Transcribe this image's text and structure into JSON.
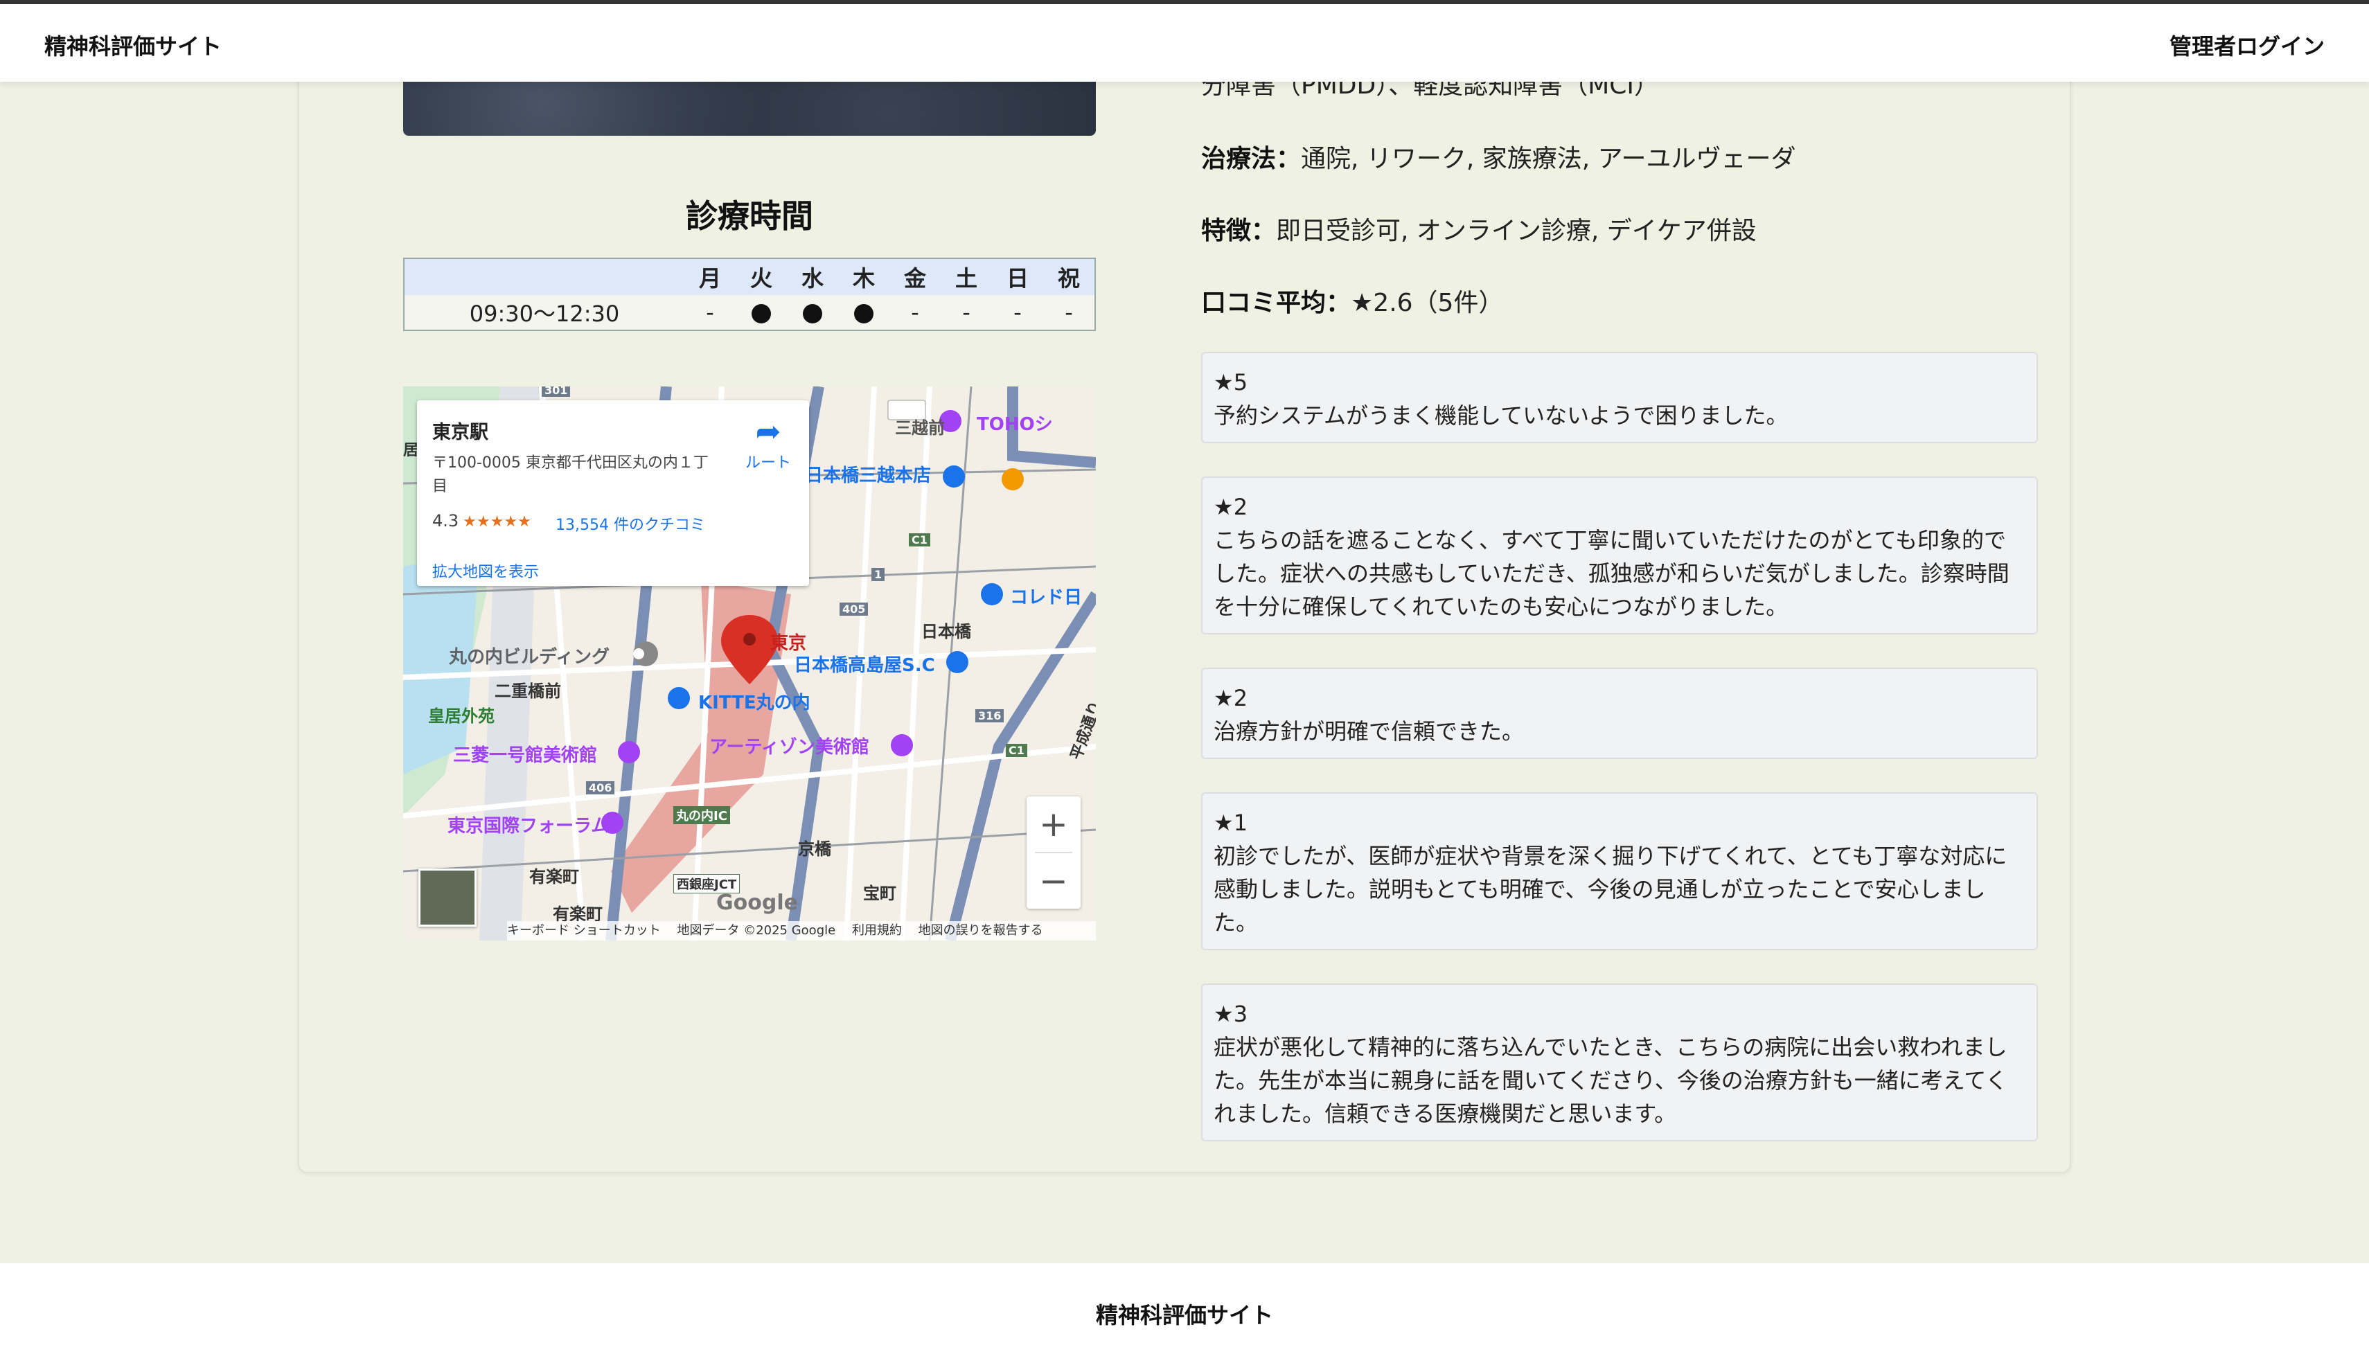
{
  "header": {
    "brand": "精神科評価サイト",
    "admin_login": "管理者ログイン"
  },
  "clinic": {
    "partial_line": "分障害（PMDD）、軽度認知障害（MCI）",
    "treatment_label": "治療法：",
    "treatment_value": "通院, リワーク, 家族療法, アーユルヴェーダ",
    "features_label": "特徴：",
    "features_value": "即日受診可, オンライン診療, デイケア併設",
    "rating_label": "口コミ平均：",
    "rating_value": "★2.6（5件）"
  },
  "hours": {
    "title": "診療時間",
    "days": [
      "月",
      "火",
      "水",
      "木",
      "金",
      "土",
      "日",
      "祝"
    ],
    "rows": [
      {
        "time": "09:30〜12:30",
        "cells": [
          "-",
          "●",
          "●",
          "●",
          "-",
          "-",
          "-",
          "-"
        ]
      }
    ]
  },
  "map": {
    "place_name": "東京駅",
    "address": "〒100-0005 東京都千代田区丸の内１丁目",
    "rating": "4.3",
    "stars": "★★★★★",
    "reviews": "13,554 件のクチコミ",
    "route_label": "ルート",
    "enlarge": "拡大地図を表示",
    "zoom_in": "+",
    "zoom_out": "−",
    "google": "Google",
    "attribution": [
      "キーボード ショートカット",
      "地図データ ©2025 Google",
      "利用規約",
      "地図の誤りを報告する"
    ],
    "labels": {
      "mitsukoshimae": "三越前",
      "toho": "TOHOシ",
      "nihonbashi_mitsukoshi": "日本橋三越本店",
      "coredo": "コレド日",
      "nihonbashi": "日本橋",
      "tokyo": "東京",
      "takashimaya": "日本橋高島屋S.C",
      "marunouchi_bldg": "丸の内ビルディング",
      "nijubashimae": "二重橋前",
      "kitte": "KITTE丸の内",
      "kokyo_gaien": "皇居外苑",
      "artizon": "アーティゾン美術館",
      "mitsubishi": "三菱一号館美術館",
      "heisei": "平成通り",
      "forum": "東京国際フォーラム",
      "marunouchi_ic": "丸の内IC",
      "kyobashi": "京橋",
      "yurakucho1": "有楽町",
      "nishiginza": "西銀座JCT",
      "takaracho": "宝町",
      "yurakucho2": "有楽町",
      "kyo": "居",
      "r301": "301",
      "r405": "405",
      "r316": "316",
      "r406": "406",
      "r1": "1",
      "c1a": "C1",
      "c1b": "C1"
    },
    "icons": [
      "pin-icon",
      "landmark-icon",
      "shopping-icon",
      "museum-icon",
      "restaurant-icon",
      "train-icon",
      "route-icon",
      "satellite-icon"
    ]
  },
  "reviews": [
    {
      "stars": "★5",
      "text": "予約システムがうまく機能していないようで困りました。"
    },
    {
      "stars": "★2",
      "text": "こちらの話を遮ることなく、すべて丁寧に聞いていただけたのがとても印象的でした。症状への共感もしていただき、孤独感が和らいだ気がしました。診察時間を十分に確保してくれていたのも安心につながりました。"
    },
    {
      "stars": "★2",
      "text": "治療方針が明確で信頼できた。"
    },
    {
      "stars": "★1",
      "text": "初診でしたが、医師が症状や背景を深く掘り下げてくれて、とても丁寧な対応に感動しました。説明もとても明確で、今後の見通しが立ったことで安心しました。"
    },
    {
      "stars": "★3",
      "text": "症状が悪化して精神的に落ち込んでいたとき、こちらの病院に出会い救われました。先生が本当に親身に話を聞いてくださり、今後の治療方針も一緒に考えてくれました。信頼できる医療機関だと思います。"
    }
  ],
  "footer": {
    "brand": "精神科評価サイト"
  },
  "colors": {
    "page_bg": "#eff1e2",
    "table_header": "#dde8f8",
    "link": "#1a73e8",
    "pin": "#d93025"
  }
}
